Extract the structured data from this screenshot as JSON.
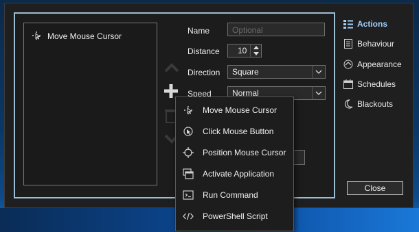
{
  "actions_list": {
    "items": [
      {
        "label": "Move Mouse Cursor",
        "icon": "move-cursor-icon"
      }
    ]
  },
  "form": {
    "name_label": "Name",
    "name_placeholder": "Optional",
    "distance_label": "Distance",
    "distance_value": "10",
    "direction_label": "Direction",
    "direction_value": "Square",
    "speed_label": "Speed",
    "speed_value": "Normal"
  },
  "side_nav": {
    "items": [
      {
        "label": "Actions",
        "icon": "list-icon",
        "active": true
      },
      {
        "label": "Behaviour",
        "icon": "document-icon",
        "active": false
      },
      {
        "label": "Appearance",
        "icon": "eye-icon",
        "active": false
      },
      {
        "label": "Schedules",
        "icon": "calendar-icon",
        "active": false
      },
      {
        "label": "Blackouts",
        "icon": "moon-icon",
        "active": false
      }
    ]
  },
  "close_label": "Close",
  "context_menu": {
    "items": [
      {
        "label": "Move Mouse Cursor",
        "icon": "move-cursor-icon"
      },
      {
        "label": "Click Mouse Button",
        "icon": "mouse-click-icon"
      },
      {
        "label": "Position Mouse Cursor",
        "icon": "crosshair-icon"
      },
      {
        "label": "Activate Application",
        "icon": "window-icon"
      },
      {
        "label": "Run Command",
        "icon": "terminal-icon"
      },
      {
        "label": "PowerShell Script",
        "icon": "code-icon"
      }
    ]
  },
  "colors": {
    "accent": "#9fd0ff",
    "panel_border": "#9cbfd6",
    "window_bg": "#1f1f1f"
  }
}
